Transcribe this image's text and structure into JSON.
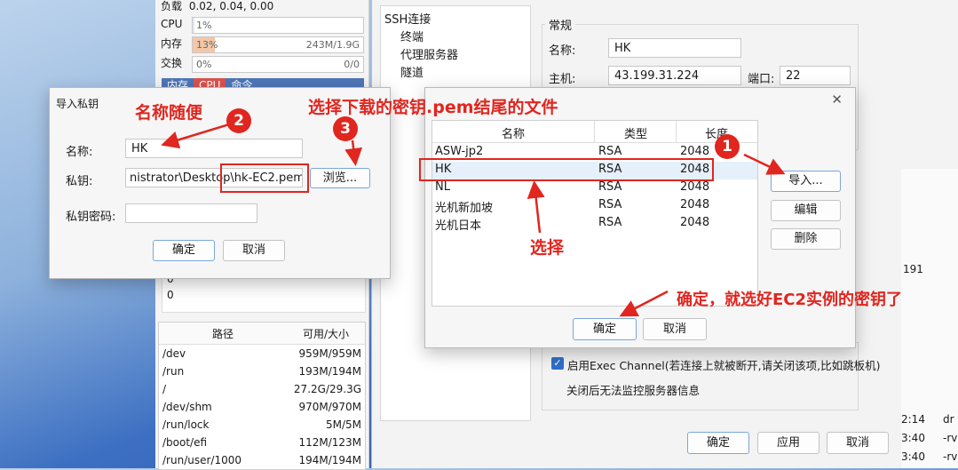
{
  "monitor": {
    "load_label": "负载",
    "load_value": "0.02, 0.04, 0.00",
    "cpu_label": "CPU",
    "cpu_pct": "1%",
    "cpu_fraction": 0.01,
    "mem_label": "内存",
    "mem_pct": "13%",
    "mem_fraction": 0.13,
    "mem_value": "243M/1.9G",
    "swap_label": "交换",
    "swap_pct": "0%",
    "swap_value": "0/0",
    "proc_tabs": [
      "内存",
      "CPU",
      "命令"
    ],
    "zeros": [
      "0",
      "0"
    ],
    "disk_headers": [
      "路径",
      "可用/大小"
    ],
    "disks": [
      {
        "path": "/dev",
        "size": "959M/959M"
      },
      {
        "path": "/run",
        "size": "193M/194M"
      },
      {
        "path": "/",
        "size": "27.2G/29.3G"
      },
      {
        "path": "/dev/shm",
        "size": "970M/970M"
      },
      {
        "path": "/run/lock",
        "size": "5M/5M"
      },
      {
        "path": "/boot/efi",
        "size": "112M/123M"
      },
      {
        "path": "/run/user/1000",
        "size": "194M/194M"
      }
    ]
  },
  "session": {
    "tree": {
      "root": "SSH连接",
      "children": [
        "终端",
        "代理服务器",
        "隧道"
      ]
    },
    "general_title": "常规",
    "name_label": "名称:",
    "name_value": "HK",
    "host_label": "主机:",
    "host_value": "43.199.31.224",
    "port_label": "端口:",
    "port_value": "22",
    "exec_channel_label": "启用Exec Channel(若连接上就被断开,请关闭该项,比如跳板机)",
    "exec_channel_checked": true,
    "monitor_note": "关闭后无法监控服务器信息",
    "ok": "确定",
    "apply": "应用",
    "cancel": "取消"
  },
  "right_strip": {
    "values": [
      "191",
      "2:14",
      "3:40",
      "3:40"
    ],
    "suffix": [
      "dr",
      "-rv",
      "-rv"
    ]
  },
  "key_dialog": {
    "headers": [
      "名称",
      "类型",
      "长度"
    ],
    "keys": [
      {
        "name": "ASW-jp2",
        "type": "RSA",
        "length": "2048"
      },
      {
        "name": "HK",
        "type": "RSA",
        "length": "2048"
      },
      {
        "name": "NL",
        "type": "RSA",
        "length": "2048"
      },
      {
        "name": "光机新加坡",
        "type": "RSA",
        "length": "2048"
      },
      {
        "name": "光机日本",
        "type": "RSA",
        "length": "2048"
      }
    ],
    "import": "导入...",
    "edit": "编辑",
    "delete": "删除",
    "ok": "确定",
    "cancel": "取消",
    "close": "✕"
  },
  "import_dialog": {
    "title": "导入私钥",
    "name_label": "名称:",
    "name_value": "HK",
    "key_label": "私钥:",
    "key_value": "nistrator\\Desktop\\hk-EC2.pem",
    "browse": "浏览...",
    "passphrase_label": "私钥密码:",
    "passphrase_value": "",
    "ok": "确定",
    "cancel": "取消"
  },
  "annotations": {
    "step1": "1",
    "step2": "2",
    "step3": "3",
    "name_hint": "名称随便",
    "file_hint": "选择下载的密钥.pem结尾的文件",
    "select_hint": "选择",
    "confirm_hint": "确定，就选好EC2实例的密钥了"
  },
  "colors": {
    "annotation_red": "#e0261f",
    "selection_blue": "#e5f0fb",
    "mem_fill": "#f3c7a7"
  }
}
